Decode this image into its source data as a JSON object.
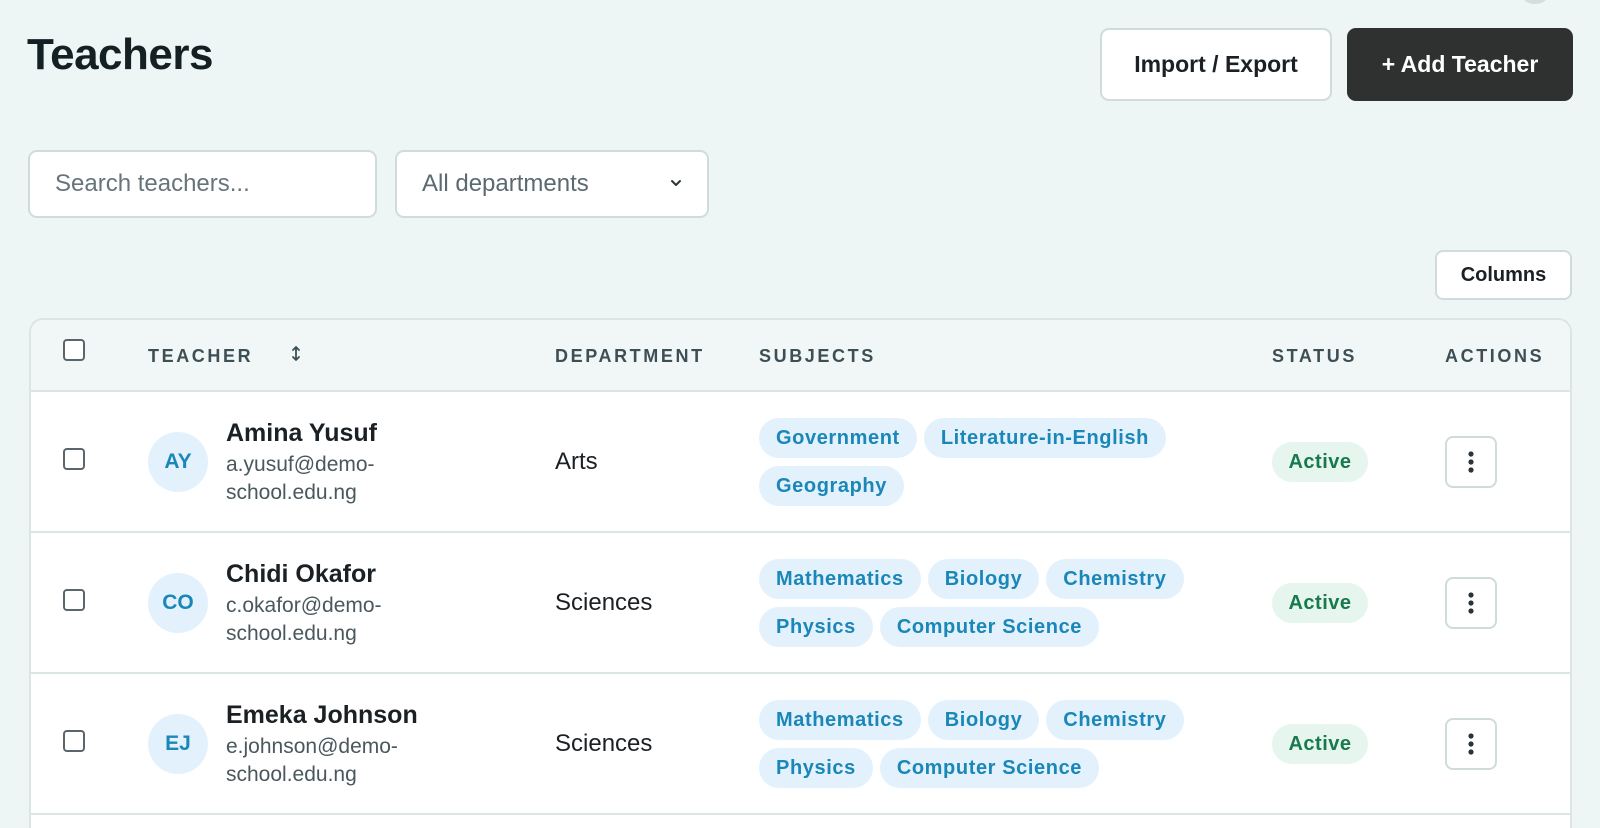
{
  "header": {
    "title": "Teachers",
    "import_export_label": "Import / Export",
    "add_teacher_label": "+ Add Teacher"
  },
  "filters": {
    "search_placeholder": "Search teachers...",
    "search_value": "",
    "department_selected": "All departments"
  },
  "toolbar": {
    "columns_label": "Columns"
  },
  "table": {
    "headers": {
      "teacher": "TEACHER",
      "department": "DEPARTMENT",
      "subjects": "SUBJECTS",
      "status": "STATUS",
      "actions": "ACTIONS"
    },
    "rows": [
      {
        "initials": "AY",
        "name": "Amina Yusuf",
        "email": "a.yusuf@demo-school.edu.ng",
        "department": "Arts",
        "subjects": [
          "Government",
          "Literature-in-English",
          "Geography"
        ],
        "status": "Active"
      },
      {
        "initials": "CO",
        "name": "Chidi Okafor",
        "email": "c.okafor@demo-school.edu.ng",
        "department": "Sciences",
        "subjects": [
          "Mathematics",
          "Biology",
          "Chemistry",
          "Physics",
          "Computer Science"
        ],
        "status": "Active"
      },
      {
        "initials": "EJ",
        "name": "Emeka Johnson",
        "email": "e.johnson@demo-school.edu.ng",
        "department": "Sciences",
        "subjects": [
          "Mathematics",
          "Biology",
          "Chemistry",
          "Physics",
          "Computer Science"
        ],
        "status": "Active"
      }
    ]
  },
  "icons": {
    "sort": "sort-icon",
    "dropdown": "chevron-down-icon",
    "row_actions": "more-vertical-icon"
  },
  "colors": {
    "background": "#eef6f5",
    "primary_button": "#2f3131",
    "tag_bg": "#e2f1fb",
    "tag_text": "#1a87b8",
    "status_bg": "#e6f6ee",
    "status_text": "#17794d"
  }
}
